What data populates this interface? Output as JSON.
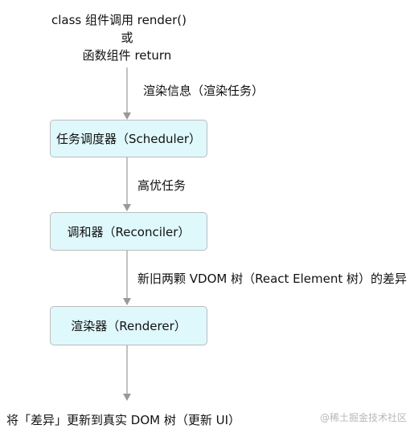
{
  "top_label": {
    "line1": "class 组件调用 render()",
    "line2": "或",
    "line3": "函数组件 return"
  },
  "edges": [
    {
      "label": "渲染信息（渲染任务）"
    },
    {
      "label": "高优任务"
    },
    {
      "label": "新旧两颗 VDOM 树（React Element 树）的差异"
    }
  ],
  "nodes": [
    {
      "label": "任务调度器（Scheduler）"
    },
    {
      "label": "调和器（Reconciler）"
    },
    {
      "label": "渲染器（Renderer）"
    }
  ],
  "bottom_label": "将「差异」更新到真实 DOM 树（更新 UI）",
  "watermark": "@稀土掘金技术社区",
  "colors": {
    "box_fill": "#dff8fb",
    "box_border": "#bcbcbc",
    "arrow": "#999999",
    "text": "#111111",
    "watermark": "#b8b8b8"
  }
}
